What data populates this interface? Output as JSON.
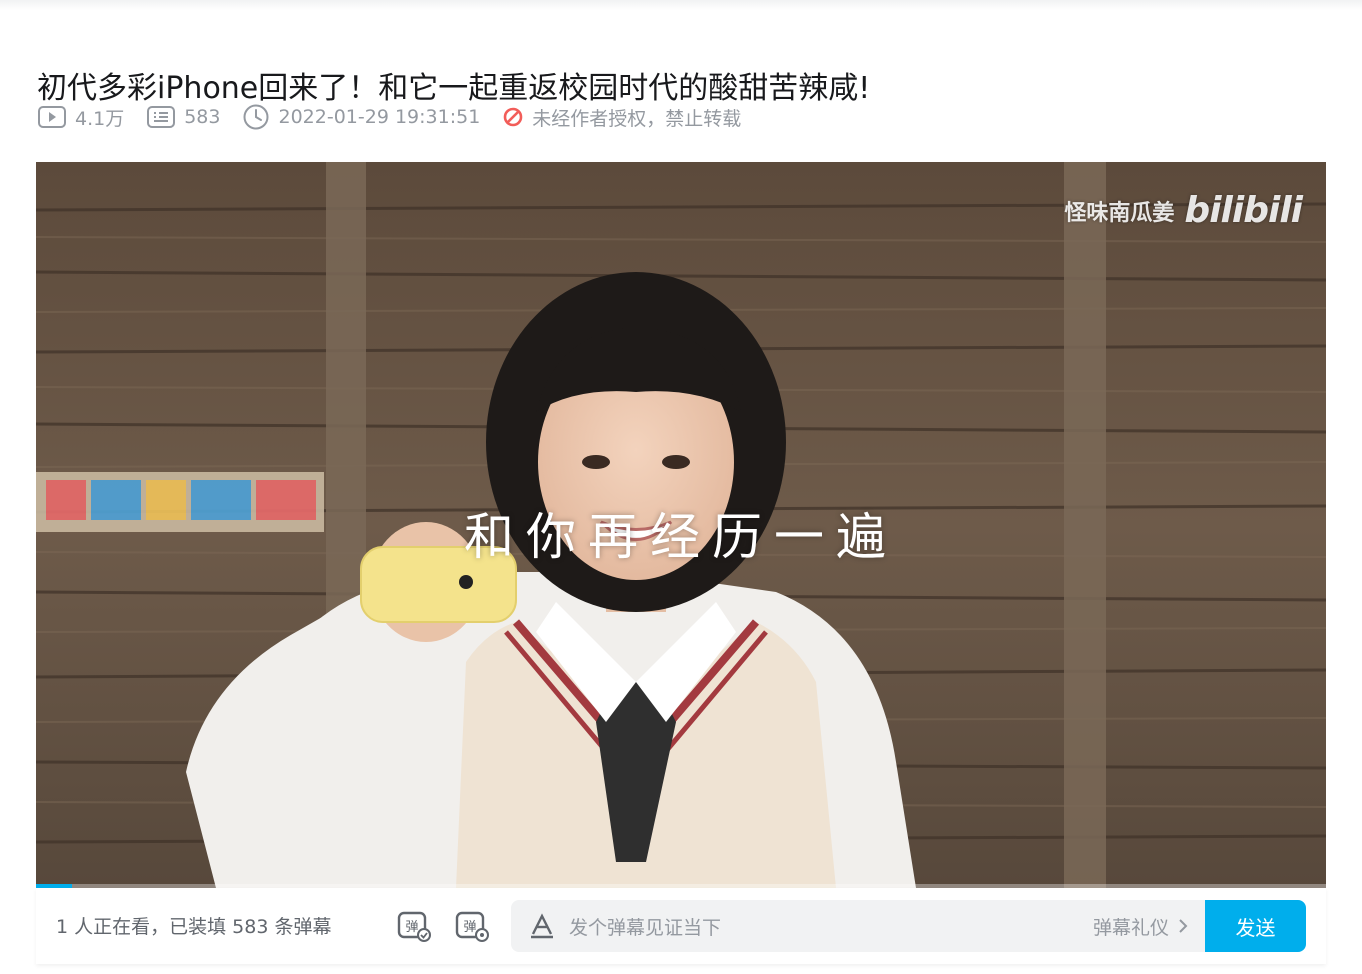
{
  "video": {
    "title": "初代多彩iPhone回来了！和它一起重返校园时代的酸甜苦辣咸!",
    "stats": {
      "views": "4.1万",
      "danmaku_count": "583",
      "publish_time": "2022-01-29 19:31:51",
      "copyright_notice": "未经作者授权，禁止转载"
    }
  },
  "player": {
    "watermark_author": "怪味南瓜姜",
    "watermark_brand": "bilibili",
    "subtitle": "和你再经历一遍",
    "progress": 0.028
  },
  "danmaku_bar": {
    "viewers_text": "1 人正在看，已装填 583 条弹幕",
    "input_placeholder": "发个弹幕见证当下",
    "etiquette_link": "弹幕礼仪",
    "send_label": "发送"
  },
  "colors": {
    "accent": "#00aeec",
    "warning": "#f25d59",
    "muted_text": "#9499a0"
  },
  "icons": {
    "views": "play-count-icon",
    "danmaku": "danmaku-count-icon",
    "time": "clock-icon",
    "copyright": "no-repost-icon",
    "danmaku_toggle": "danmaku-toggle-icon",
    "danmaku_settings": "danmaku-settings-icon",
    "font_style": "text-style-icon",
    "chevron": "chevron-right-icon"
  }
}
